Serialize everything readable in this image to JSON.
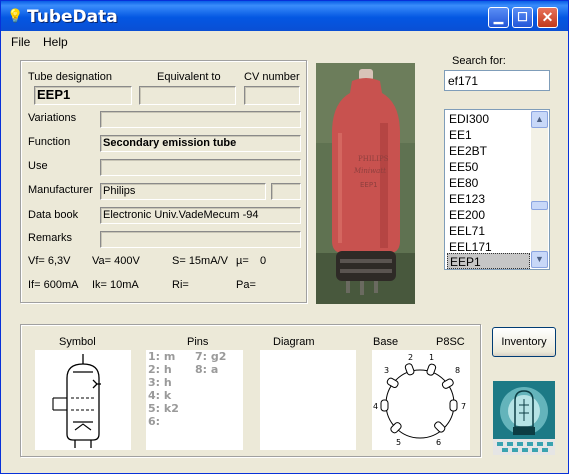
{
  "window": {
    "title": "TubeData"
  },
  "menu": [
    "File",
    "Help"
  ],
  "labels": {
    "tube_designation": "Tube designation",
    "equivalent_to": "Equivalent to",
    "cv_number": "CV number",
    "variations": "Variations",
    "function": "Function",
    "use": "Use",
    "manufacturer": "Manufacturer",
    "data_book": "Data book",
    "remarks": "Remarks",
    "search_for": "Search for:"
  },
  "fields": {
    "tube_designation": "EEP1",
    "equivalent_to": "",
    "cv_number": "",
    "variations": "",
    "function": "Secondary emission tube",
    "use": "",
    "manufacturer": "Philips",
    "manufacturer_extra": "",
    "data_book": "Electronic Univ.VadeMecum -94",
    "remarks": ""
  },
  "params": {
    "vf": "Vf= 6,3V",
    "va": "Va= 400V",
    "s": "S= 15mA/V",
    "mu": "µ=",
    "mu_val": "0",
    "if": "If= 600mA",
    "ik": "Ik= 10mA",
    "ri": "Ri=",
    "pa": "Pa="
  },
  "search": {
    "value": "ef171"
  },
  "tube_list": {
    "items": [
      "EDI300",
      "EE1",
      "EE2BT",
      "EE50",
      "EE80",
      "EE123",
      "EE200",
      "EEL71",
      "EEL171",
      "EEP1"
    ],
    "selected": "EEP1"
  },
  "photo_text": [
    "PHILIPS",
    "Miniwatt",
    "EEP1"
  ],
  "bottom": {
    "symbol_label": "Symbol",
    "pins_label": "Pins",
    "diagram_label": "Diagram",
    "base_label": "Base",
    "base_type": "P8SC",
    "pins_col1": "1: m\n2: h\n3: h\n4: k\n5: k2\n6:",
    "pins_col2": "7: g2\n8: a"
  },
  "base_pins": [
    "1",
    "2",
    "3",
    "4",
    "5",
    "6",
    "7",
    "8"
  ],
  "inventory_label": "Inventory"
}
